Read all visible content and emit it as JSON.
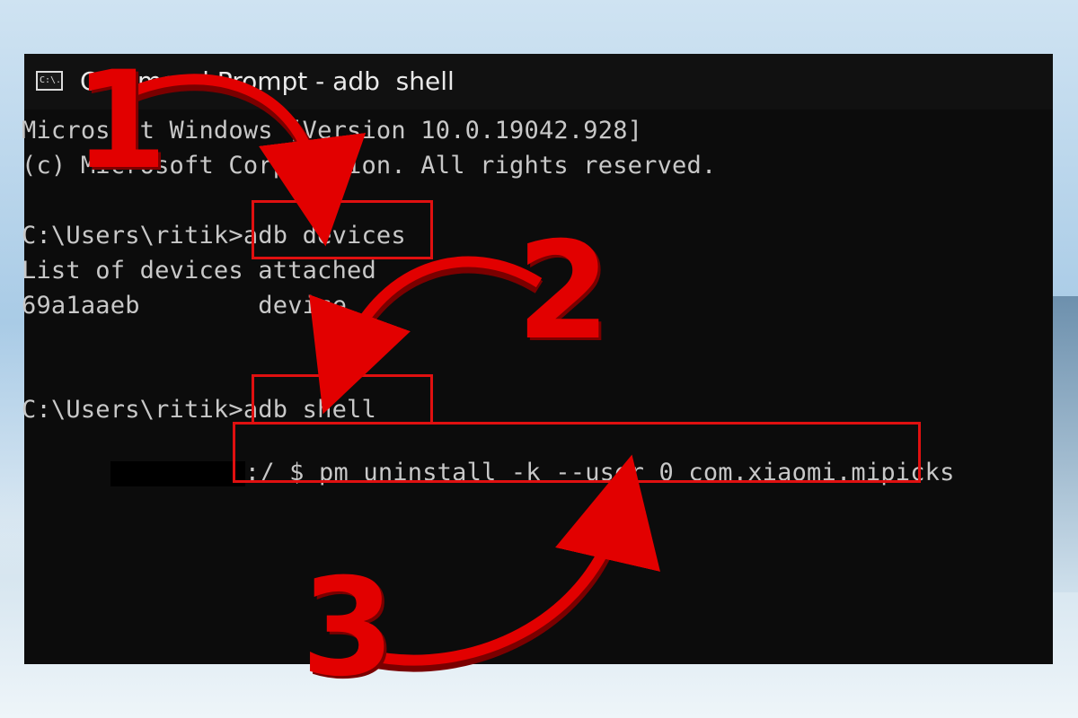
{
  "window": {
    "title": "Command Prompt - adb  shell",
    "icon": "command-prompt-icon",
    "icon_text": "C:\\."
  },
  "console": {
    "lines": [
      "Microsoft Windows [Version 10.0.19042.928]",
      "(c) Microsoft Corporation. All rights reserved.",
      "",
      "C:\\Users\\ritik>adb devices",
      "List of devices attached",
      "69a1aaeb        device",
      "",
      "C:\\Users\\ritik>adb shell",
      ":/ $ pm uninstall -k --user 0 com.xiaomi.mipicks"
    ],
    "prompt_suffix": ":/ $ ",
    "last_command": "pm uninstall -k --user 0 com.xiaomi.mipicks"
  },
  "annotations": {
    "step_numbers": [
      "1",
      "2",
      "3"
    ],
    "highlight_color": "#e01010",
    "arrow_color": "#e20000"
  }
}
